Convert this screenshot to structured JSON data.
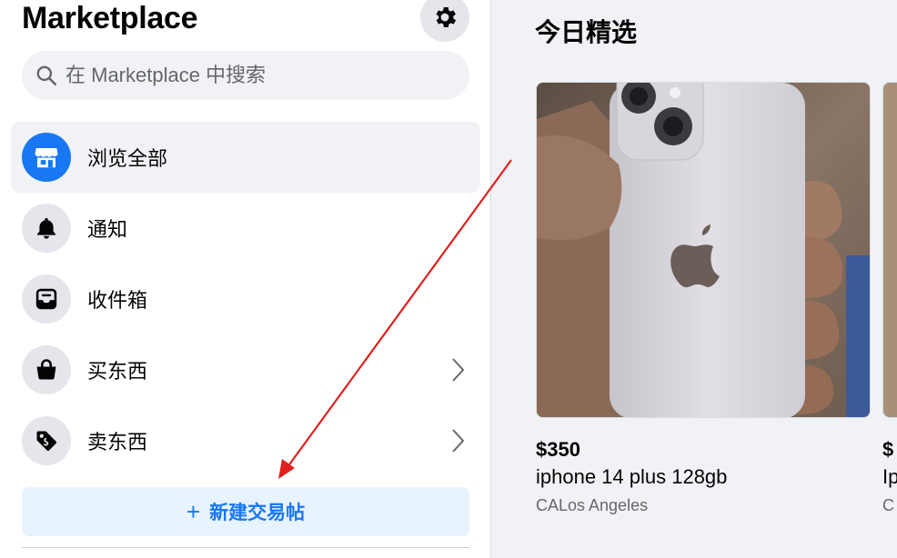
{
  "sidebar": {
    "title": "Marketplace",
    "search_placeholder": "在 Marketplace 中搜索",
    "items": [
      {
        "label": "浏览全部",
        "icon": "storefront-icon"
      },
      {
        "label": "通知",
        "icon": "bell-icon"
      },
      {
        "label": "收件箱",
        "icon": "inbox-icon"
      },
      {
        "label": "买东西",
        "icon": "shopping-bag-icon"
      },
      {
        "label": "卖东西",
        "icon": "tag-icon"
      }
    ],
    "new_listing_label": "新建交易帖",
    "new_listing_plus": "+"
  },
  "main": {
    "section_title": "今日精选",
    "listings": [
      {
        "price": "$350",
        "title": "iphone 14 plus 128gb",
        "location": "CALos Angeles"
      },
      {
        "price": "$",
        "title": "Ip",
        "location": "C"
      }
    ]
  },
  "colors": {
    "accent": "#1877f2",
    "active_bg": "#f0f2f5",
    "annotation_arrow": "#e0201e"
  }
}
